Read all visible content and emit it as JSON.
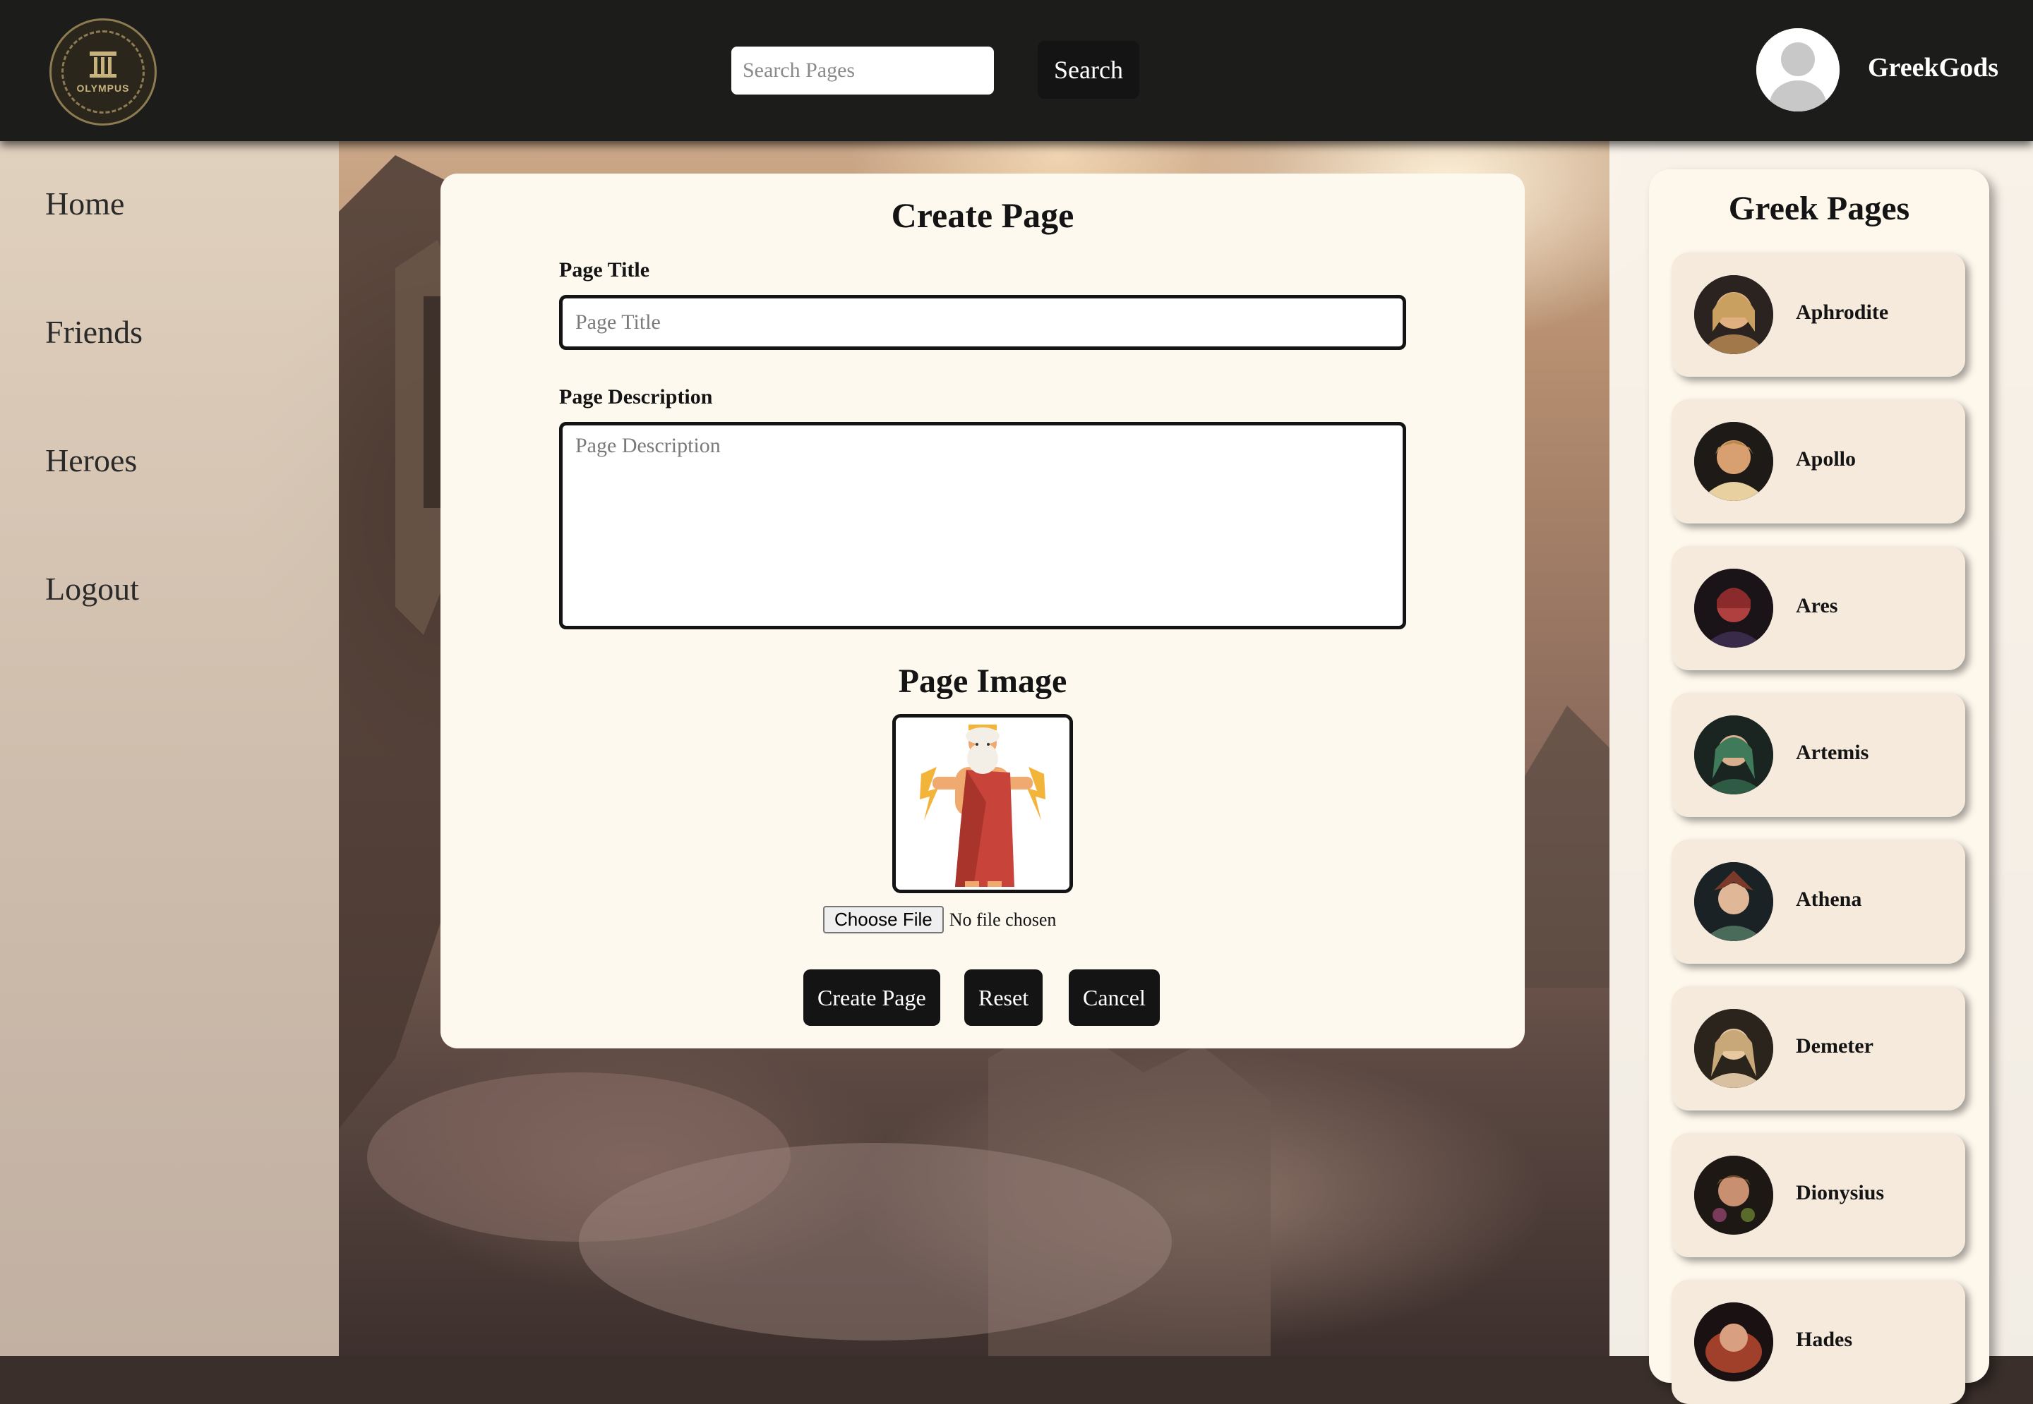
{
  "header": {
    "logo_text": "OLYMPUS",
    "search_placeholder": "Search Pages",
    "search_button": "Search",
    "username": "GreekGods"
  },
  "nav": {
    "items": [
      {
        "label": "Home"
      },
      {
        "label": "Friends"
      },
      {
        "label": "Heroes"
      },
      {
        "label": "Logout"
      }
    ]
  },
  "create_page": {
    "title": "Create Page",
    "page_title_label": "Page Title",
    "page_title_placeholder": "Page Title",
    "page_description_label": "Page Description",
    "page_description_placeholder": "Page Description",
    "page_image_label": "Page Image",
    "choose_file_button": "Choose File",
    "file_status": "No file chosen",
    "buttons": {
      "create": "Create Page",
      "reset": "Reset",
      "cancel": "Cancel"
    }
  },
  "greek_pages": {
    "title": "Greek Pages",
    "items": [
      {
        "name": "Aphrodite",
        "color": "#c9a060"
      },
      {
        "name": "Apollo",
        "color": "#b88a4a"
      },
      {
        "name": "Ares",
        "color": "#8a2a2a"
      },
      {
        "name": "Artemis",
        "color": "#3f7a5a"
      },
      {
        "name": "Athena",
        "color": "#7a3a2a"
      },
      {
        "name": "Demeter",
        "color": "#c8a878"
      },
      {
        "name": "Dionysius",
        "color": "#6a4a2a"
      },
      {
        "name": "Hades",
        "color": "#a0402a"
      }
    ]
  },
  "colors": {
    "header_bg": "#1c1c1a",
    "card_bg": "#fef9ef",
    "button_bg": "#141414"
  }
}
